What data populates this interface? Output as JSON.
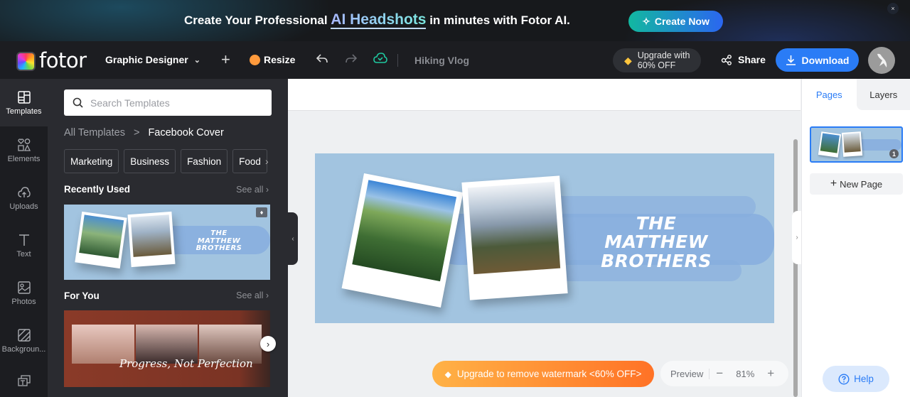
{
  "promo": {
    "text_before": "Create Your Professional ",
    "highlight": "AI Headshots",
    "text_after": " in minutes with Fotor AI.",
    "cta_label": "Create Now",
    "close_label": "×"
  },
  "topbar": {
    "brand": "fotor",
    "workspace_label": "Graphic Designer",
    "resize_label": "Resize",
    "document_title": "Hiking Vlog",
    "upgrade_line1": "Upgrade with",
    "upgrade_line2": "60% OFF",
    "share_label": "Share",
    "download_label": "Download"
  },
  "rail": {
    "items": [
      {
        "label": "Templates",
        "active": true
      },
      {
        "label": "Elements"
      },
      {
        "label": "Uploads"
      },
      {
        "label": "Text"
      },
      {
        "label": "Photos"
      },
      {
        "label": "Backgroun..."
      }
    ]
  },
  "panel": {
    "search_placeholder": "Search Templates",
    "breadcrumb_root": "All Templates",
    "breadcrumb_sep": ">",
    "breadcrumb_current": "Facebook Cover",
    "chips": [
      "Marketing",
      "Business",
      "Fashion",
      "Food"
    ],
    "recent_title": "Recently Used",
    "for_you_title": "For You",
    "see_all": "See all",
    "recent_thumb_title_line1": "THE",
    "recent_thumb_title_line2": "MATTHEW BROTHERS",
    "for_you_thumb_text": "Progress, Not Perfection"
  },
  "canvas": {
    "design_title_line1": "THE",
    "design_title_line2": "MATTHEW BROTHERS",
    "watermark_label": "Upgrade to remove watermark <60% OFF>",
    "preview_label": "Preview",
    "zoom_value": "81%",
    "zoom_minus": "−",
    "zoom_plus": "+"
  },
  "rpanel": {
    "tabs": [
      {
        "label": "Pages",
        "active": true
      },
      {
        "label": "Layers"
      }
    ],
    "page_number": "1",
    "new_page_label": "New Page",
    "help_label": "Help"
  },
  "colors": {
    "accent": "#2a7cf6",
    "promo_cta_start": "#12b8a0",
    "promo_cta_end": "#2b66f0",
    "watermark_start": "#ffb246",
    "watermark_end": "#ff7226",
    "design_bg": "#a2c4e0"
  }
}
